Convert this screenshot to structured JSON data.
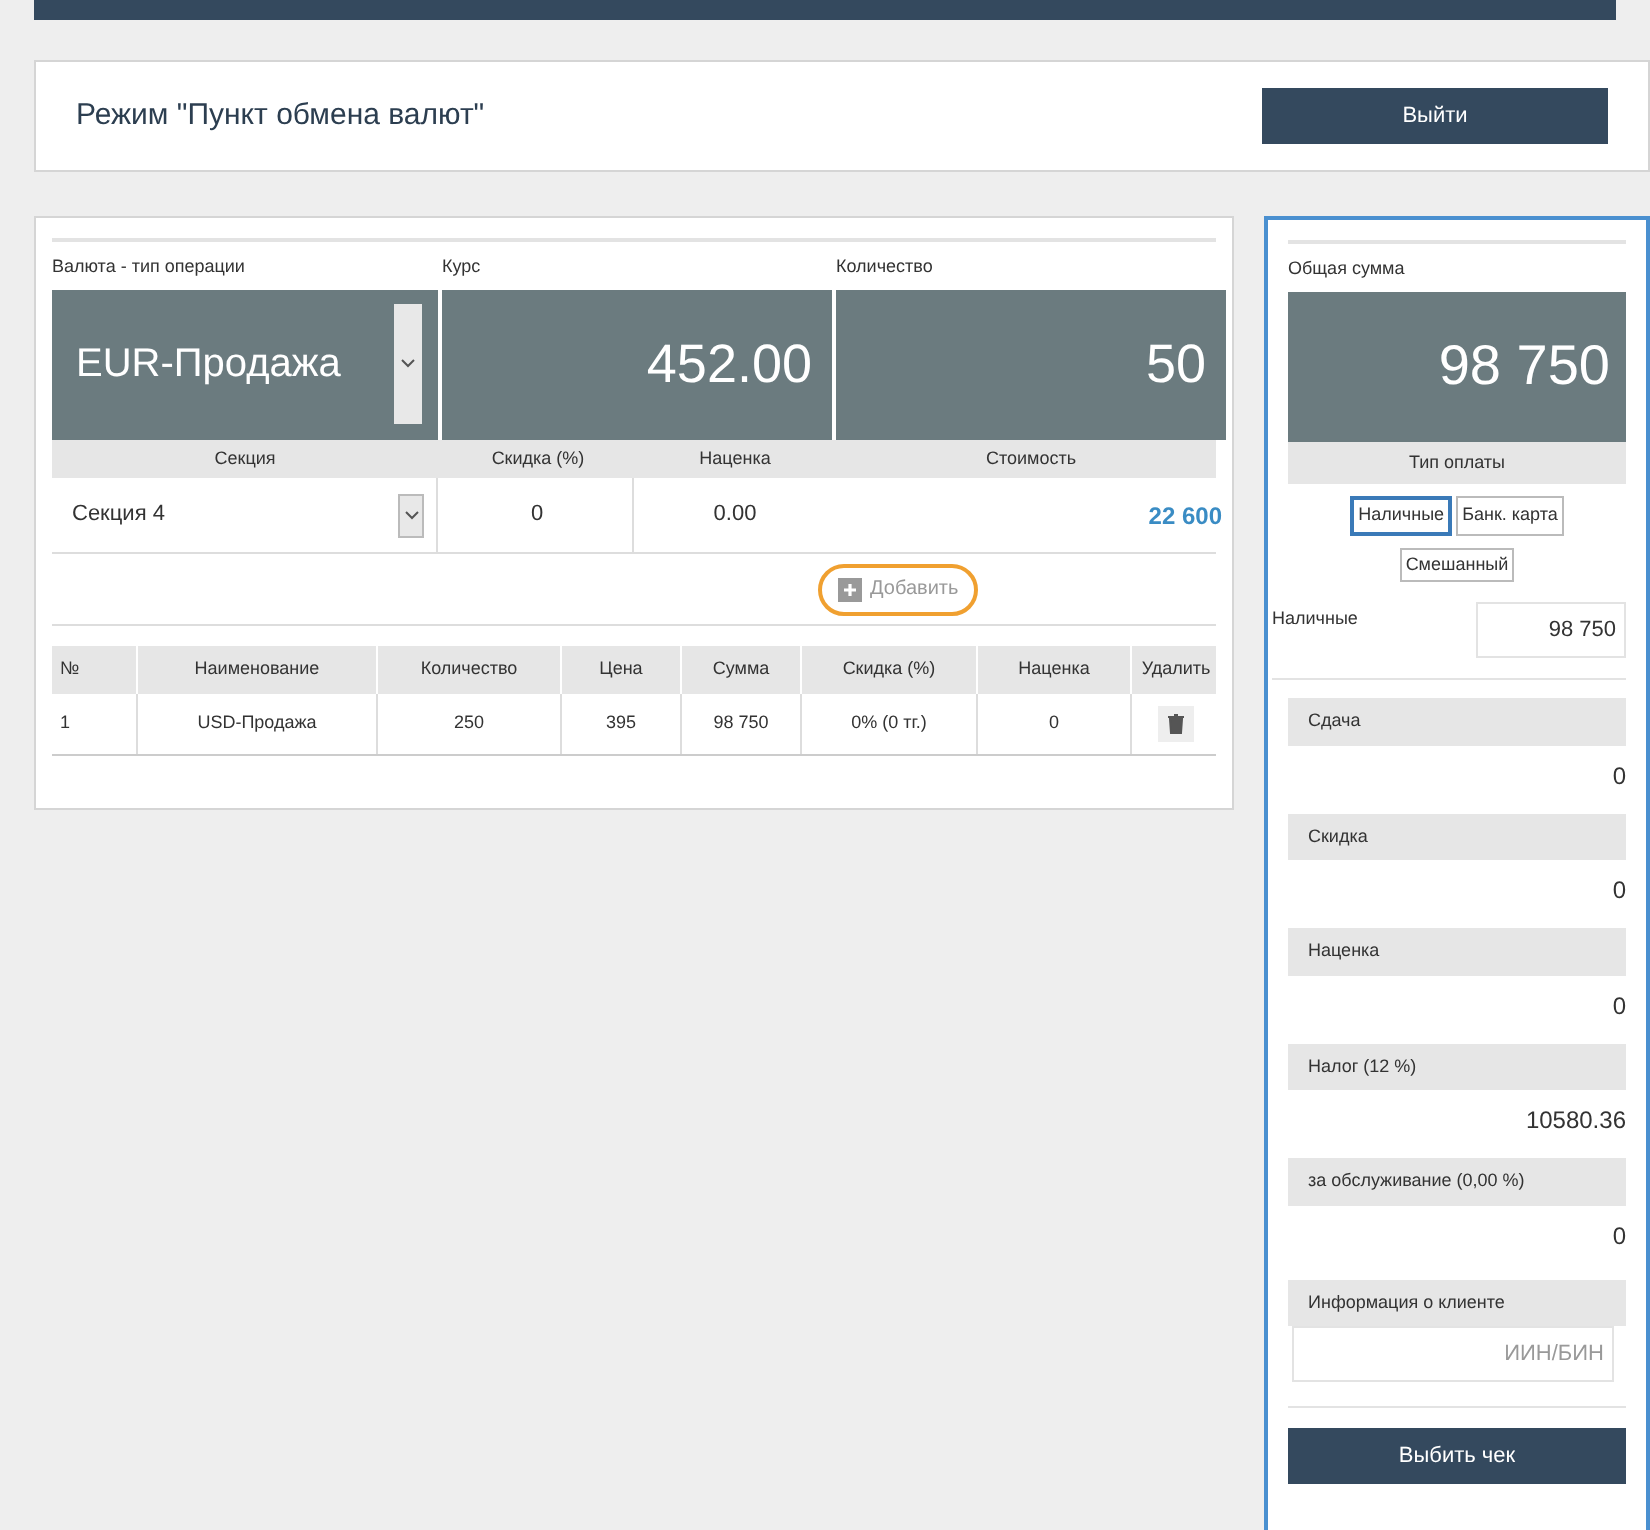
{
  "header": {
    "title": "Режим \"Пункт обмена валют\"",
    "exit_button": "Выйти"
  },
  "entry": {
    "currency_label": "Валюта - тип операции",
    "currency_value": "EUR-Продажа",
    "rate_label": "Курс",
    "rate_value": "452.00",
    "quantity_label": "Количество",
    "quantity_value": "50",
    "section_label": "Секция",
    "section_value": "Секция 4",
    "discount_label": "Скидка (%)",
    "discount_value": "0",
    "markup_label": "Наценка",
    "markup_value": "0.00",
    "cost_label": "Стоимость",
    "cost_value": "22 600",
    "add_button": "Добавить",
    "add_highlighted": true
  },
  "table": {
    "columns": [
      "№",
      "Наименование",
      "Количество",
      "Цена",
      "Сумма",
      "Скидка (%)",
      "Наценка",
      "Удалить"
    ],
    "rows": [
      {
        "cells": [
          "1",
          "USD-Продажа",
          "250",
          "395",
          "98 750",
          "0% (0 тг.)",
          "0"
        ]
      }
    ]
  },
  "summary": {
    "total_label": "Общая сумма",
    "total_value": "98 750",
    "payment_label": "Тип оплаты",
    "payment_types": [
      {
        "label": "Наличные",
        "selected": true
      },
      {
        "label": "Банк. карта",
        "selected": false
      },
      {
        "label": "Смешанный",
        "selected": false
      }
    ],
    "cash_label": "Наличные",
    "cash_value": "98 750",
    "items": [
      {
        "label": "Сдача",
        "value": "0"
      },
      {
        "label": "Скидка",
        "value": "0"
      },
      {
        "label": "Наценка",
        "value": "0"
      },
      {
        "label": "Налог (12 %)",
        "value": "10580.36"
      },
      {
        "label": "за обслуживание (0,00 %)",
        "value": "0"
      }
    ],
    "client_label": "Информация о клиенте",
    "client_placeholder": "ИИН/БИН",
    "print_button": "Выбить чек"
  }
}
